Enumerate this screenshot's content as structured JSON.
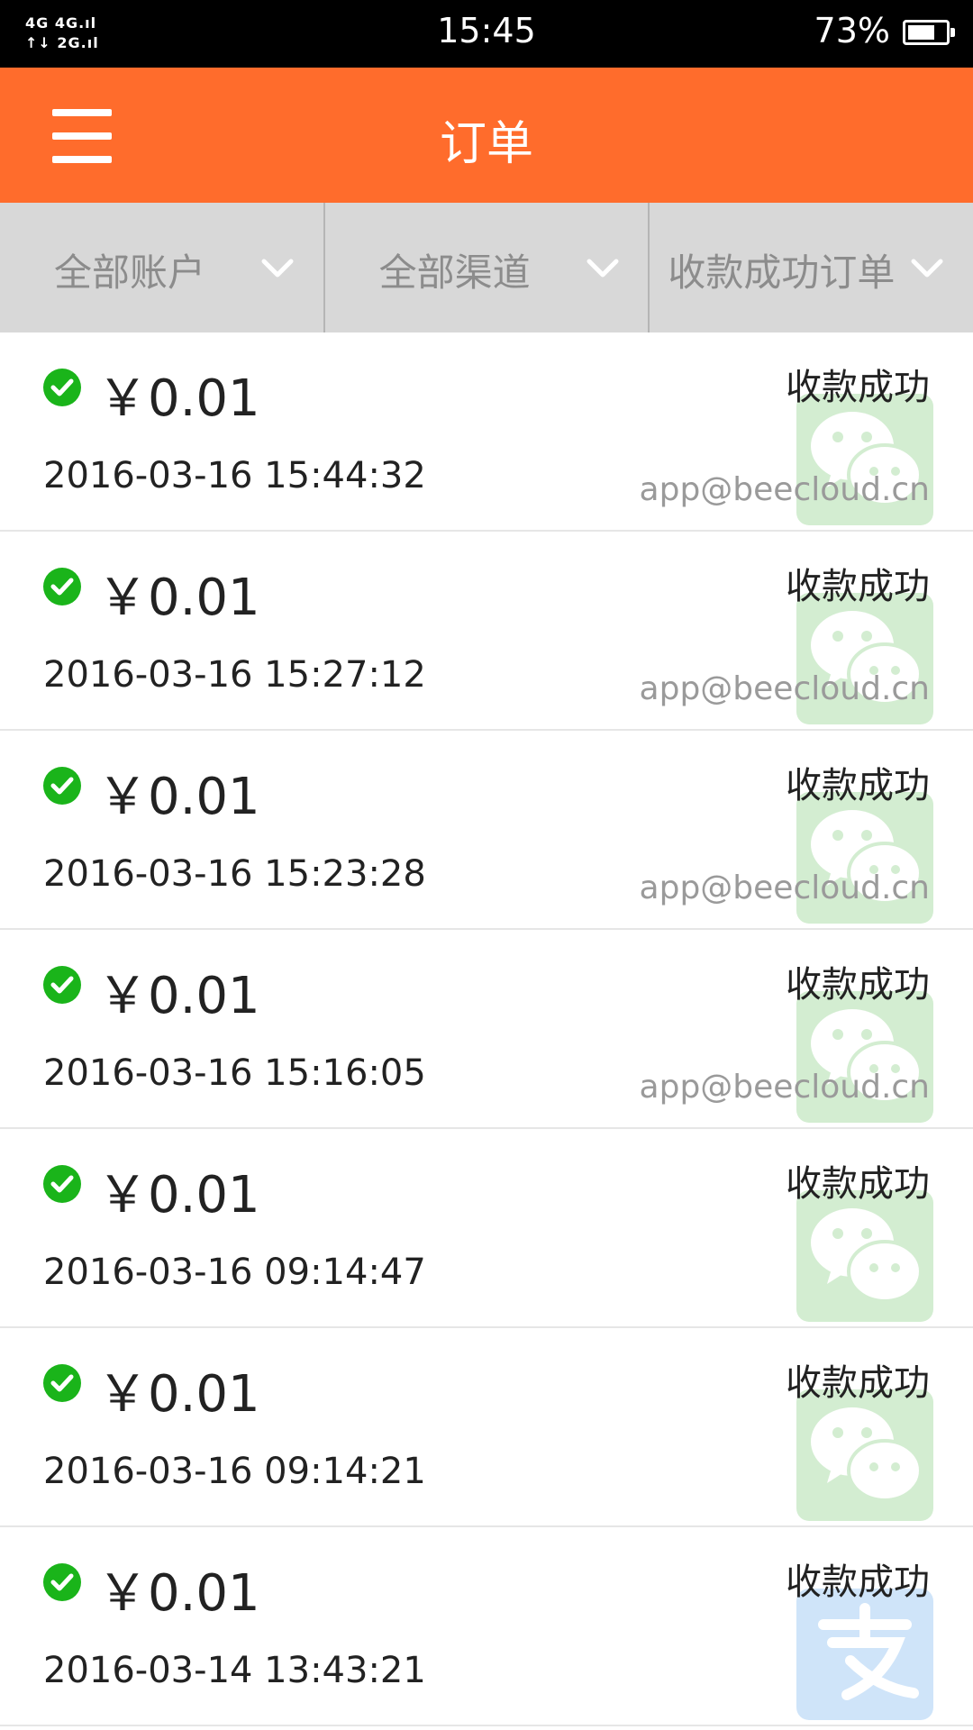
{
  "status_bar": {
    "network_line1": "4G 4G.ıl",
    "network_line2": "↑↓ 2G.ıl",
    "time": "15:45",
    "battery": "73%",
    "battery_level": 0.73
  },
  "header": {
    "title": "订单",
    "menu_icon": "hamburger-menu-icon"
  },
  "filters": [
    {
      "label": "全部账户",
      "icon": "chevron-down-icon"
    },
    {
      "label": "全部渠道",
      "icon": "chevron-down-icon"
    },
    {
      "label": "收款成功订单",
      "icon": "chevron-down-icon"
    }
  ],
  "colors": {
    "header": "#ff6c2c",
    "filter_bar": "#d8d8d8",
    "success_green": "#1ab41a",
    "wechat_green": "#3cb034",
    "alipay_blue": "#2b8ae6"
  },
  "orders": [
    {
      "amount": "￥0.01",
      "datetime": "2016-03-16 15:44:32",
      "status": "收款成功",
      "account": "app@beecloud.cn",
      "channel": "wechat-pay-icon"
    },
    {
      "amount": "￥0.01",
      "datetime": "2016-03-16 15:27:12",
      "status": "收款成功",
      "account": "app@beecloud.cn",
      "channel": "wechat-pay-icon"
    },
    {
      "amount": "￥0.01",
      "datetime": "2016-03-16 15:23:28",
      "status": "收款成功",
      "account": "app@beecloud.cn",
      "channel": "wechat-pay-icon"
    },
    {
      "amount": "￥0.01",
      "datetime": "2016-03-16 15:16:05",
      "status": "收款成功",
      "account": "app@beecloud.cn",
      "channel": "wechat-pay-icon"
    },
    {
      "amount": "￥0.01",
      "datetime": "2016-03-16 09:14:47",
      "status": "收款成功",
      "account": "",
      "channel": "wechat-pay-icon"
    },
    {
      "amount": "￥0.01",
      "datetime": "2016-03-16 09:14:21",
      "status": "收款成功",
      "account": "",
      "channel": "wechat-pay-icon"
    },
    {
      "amount": "￥0.01",
      "datetime": "2016-03-14 13:43:21",
      "status": "收款成功",
      "account": "",
      "channel": "alipay-icon"
    }
  ]
}
